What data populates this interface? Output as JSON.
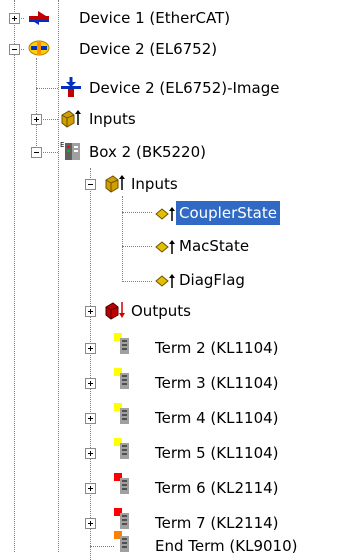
{
  "tree": {
    "device1": "Device 1 (EtherCAT)",
    "device2": "Device 2 (EL6752)",
    "device2_image": "Device 2 (EL6752)-Image",
    "inputs": "Inputs",
    "box2": "Box 2 (BK5220)",
    "box_inputs": "Inputs",
    "coupler_state": "CouplerState",
    "mac_state": "MacState",
    "diag_flag": "DiagFlag",
    "outputs": "Outputs",
    "term2": "Term 2 (KL1104)",
    "term3": "Term 3 (KL1104)",
    "term4": "Term 4 (KL1104)",
    "term5": "Term 5 (KL1104)",
    "term6": "Term 6 (KL2114)",
    "term7": "Term 7 (KL2114)",
    "end_term": "End Term (KL9010)"
  },
  "colors": {
    "selection": "#316ac5",
    "input_term": "#ffff00",
    "output_term": "#ff0000",
    "end_term": "#ff8000"
  }
}
